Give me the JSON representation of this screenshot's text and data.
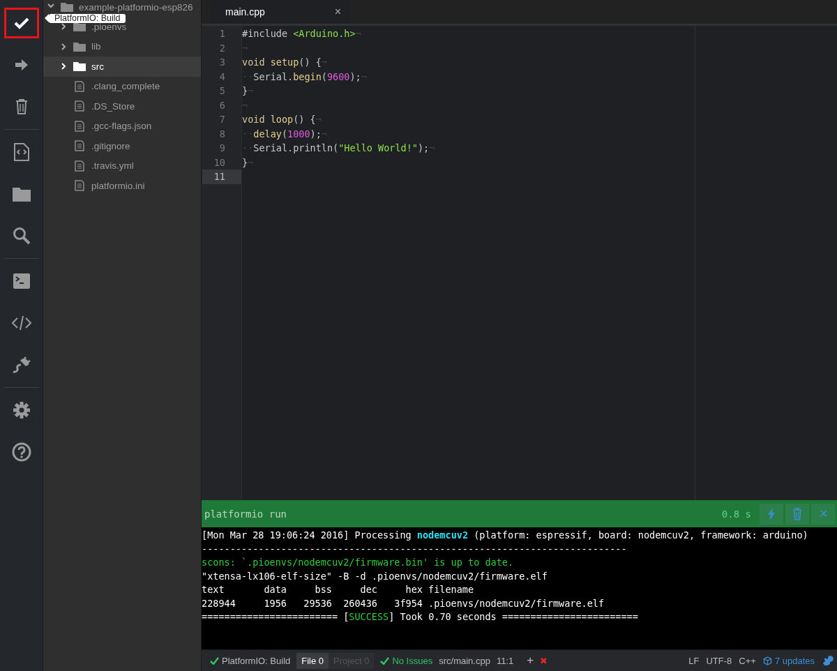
{
  "toolbar": {
    "groups": [
      [
        {
          "kind": "check",
          "selected": true
        },
        {
          "kind": "arrow",
          "selected": false
        },
        {
          "kind": "trash",
          "selected": false
        }
      ],
      [
        {
          "kind": "codefile",
          "selected": false
        },
        {
          "kind": "folder",
          "selected": false
        },
        {
          "kind": "search",
          "selected": false
        }
      ],
      [
        {
          "kind": "terminal",
          "selected": false
        },
        {
          "kind": "brackets",
          "selected": false
        },
        {
          "kind": "plug",
          "selected": false
        }
      ],
      [
        {
          "kind": "gear",
          "selected": false
        },
        {
          "kind": "help",
          "selected": false
        }
      ]
    ],
    "tooltip": "PlatformIO: Build"
  },
  "tree": {
    "root": {
      "label": "example-platformio-esp826",
      "expanded": true,
      "children": [
        {
          "label": ".pioenvs",
          "kind": "folder",
          "selected": false
        },
        {
          "label": "lib",
          "kind": "folder",
          "selected": false
        },
        {
          "label": "src",
          "kind": "folder",
          "selected": true
        },
        {
          "label": ".clang_complete",
          "kind": "file",
          "selected": false
        },
        {
          "label": ".DS_Store",
          "kind": "file",
          "selected": false
        },
        {
          "label": ".gcc-flags.json",
          "kind": "file",
          "selected": false
        },
        {
          "label": ".gitignore",
          "kind": "file",
          "selected": false
        },
        {
          "label": ".travis.yml",
          "kind": "file",
          "selected": false
        },
        {
          "label": "platformio.ini",
          "kind": "file",
          "selected": false
        }
      ]
    }
  },
  "tabs": [
    {
      "label": "main.cpp",
      "close": "×",
      "selected": true
    }
  ],
  "code": [
    {
      "number": "1",
      "current": false,
      "tokens": [
        {
          "text": "#include ",
          "kind": "plain"
        },
        {
          "text": "<Arduino.h>",
          "kind": "string"
        },
        {
          "text": "¬",
          "kind": "invisible"
        }
      ]
    },
    {
      "number": "2",
      "current": false,
      "tokens": [
        {
          "text": "¬",
          "kind": "invisible"
        }
      ]
    },
    {
      "number": "3",
      "current": false,
      "tokens": [
        {
          "text": "void ",
          "kind": "keyword"
        },
        {
          "text": "setup",
          "kind": "function"
        },
        {
          "text": "() {",
          "kind": "plain"
        },
        {
          "text": "¬",
          "kind": "invisible"
        }
      ]
    },
    {
      "number": "4",
      "current": false,
      "tokens": [
        {
          "text": "··",
          "kind": "invisible"
        },
        {
          "text": "Serial.",
          "kind": "plain"
        },
        {
          "text": "begin",
          "kind": "function"
        },
        {
          "text": "(",
          "kind": "plain"
        },
        {
          "text": "9600",
          "kind": "number"
        },
        {
          "text": ");",
          "kind": "plain"
        },
        {
          "text": "¬",
          "kind": "invisible"
        }
      ]
    },
    {
      "number": "5",
      "current": false,
      "tokens": [
        {
          "text": "}",
          "kind": "plain"
        },
        {
          "text": "¬",
          "kind": "invisible"
        }
      ]
    },
    {
      "number": "6",
      "current": false,
      "tokens": [
        {
          "text": "¬",
          "kind": "invisible"
        }
      ]
    },
    {
      "number": "7",
      "current": false,
      "tokens": [
        {
          "text": "void ",
          "kind": "keyword"
        },
        {
          "text": "loop",
          "kind": "function"
        },
        {
          "text": "() {",
          "kind": "plain"
        },
        {
          "text": "¬",
          "kind": "invisible"
        }
      ]
    },
    {
      "number": "8",
      "current": false,
      "tokens": [
        {
          "text": "··",
          "kind": "invisible"
        },
        {
          "text": "delay",
          "kind": "function"
        },
        {
          "text": "(",
          "kind": "plain"
        },
        {
          "text": "1000",
          "kind": "number"
        },
        {
          "text": ");",
          "kind": "plain"
        },
        {
          "text": "¬",
          "kind": "invisible"
        }
      ]
    },
    {
      "number": "9",
      "current": false,
      "tokens": [
        {
          "text": "··",
          "kind": "invisible"
        },
        {
          "text": "Serial.println(",
          "kind": "plain"
        },
        {
          "text": "\"Hello World!\"",
          "kind": "string"
        },
        {
          "text": ");",
          "kind": "plain"
        },
        {
          "text": "¬",
          "kind": "invisible"
        }
      ]
    },
    {
      "number": "10",
      "current": false,
      "tokens": [
        {
          "text": "}",
          "kind": "plain"
        },
        {
          "text": "¬",
          "kind": "invisible"
        }
      ]
    },
    {
      "number": "11",
      "current": true
    }
  ],
  "terminal": {
    "title": "platformio run",
    "elapsed": "0.8 s",
    "buttons": [
      {
        "kind": "bolt"
      },
      {
        "kind": "trash"
      },
      {
        "kind": "close",
        "text": "✕"
      }
    ],
    "lines": [
      [
        {
          "text": "[Mon Mar 28 19:06:24 2016] Processing ",
          "kind": "plain"
        },
        {
          "text": "nodemcuv2",
          "kind": "cyan"
        },
        {
          "text": " (platform: espressif, board: nodemcuv2, framework: arduino)",
          "kind": "plain"
        }
      ],
      [
        {
          "text": "---------------------------------------------------------------------------",
          "kind": "plain"
        }
      ],
      [
        {
          "text": "scons: `.pioenvs/nodemcuv2/firmware.bin' is up to date.",
          "kind": "green"
        }
      ],
      [
        {
          "text": "\"xtensa-lx106-elf-size\" -B -d .pioenvs/nodemcuv2/firmware.elf",
          "kind": "plain"
        }
      ],
      [
        {
          "text": "text       data     bss     dec     hex filename",
          "kind": "plain"
        }
      ],
      [
        {
          "text": "228944     1956   29536  260436   3f954 .pioenvs/nodemcuv2/firmware.elf",
          "kind": "plain"
        }
      ],
      [
        {
          "text": "======================== [",
          "kind": "plain"
        },
        {
          "text": "SUCCESS",
          "kind": "green"
        },
        {
          "text": "] Took 0.70 seconds ========================",
          "kind": "plain"
        }
      ]
    ]
  },
  "status_bar": {
    "left": [
      {
        "kind": "build",
        "text": "PlatformIO: Build"
      },
      {
        "kind": "count",
        "text": "File 0",
        "selected": true
      },
      {
        "kind": "count",
        "text": "Project 0",
        "selected": false
      },
      {
        "kind": "issues",
        "text": "No Issues"
      },
      {
        "kind": "text",
        "text": "src/main.cpp"
      },
      {
        "kind": "text",
        "text": "11:1"
      },
      {
        "kind": "plus",
        "text": "+"
      },
      {
        "kind": "error",
        "text": "✖"
      }
    ],
    "right": [
      {
        "kind": "text",
        "text": "LF"
      },
      {
        "kind": "text",
        "text": "UTF-8"
      },
      {
        "kind": "text",
        "text": "C++"
      },
      {
        "kind": "updates",
        "text": "7 updates"
      },
      {
        "kind": "squirrel"
      }
    ]
  }
}
